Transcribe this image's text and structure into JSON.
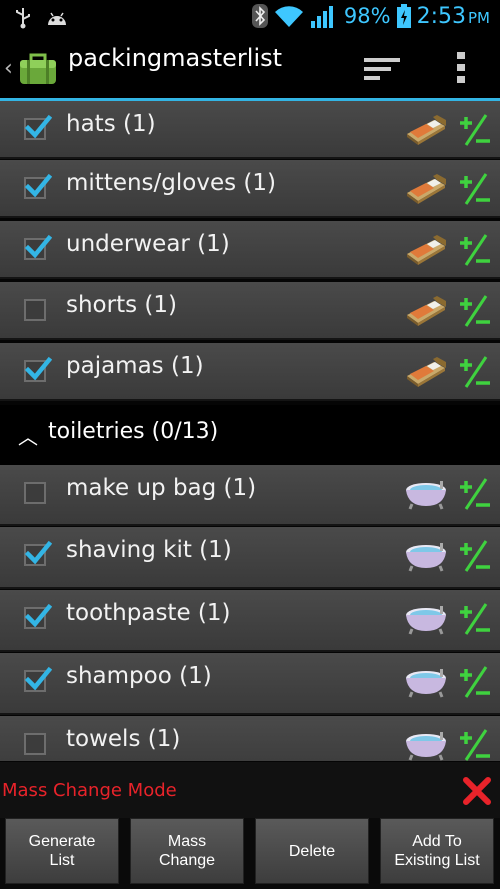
{
  "status_bar": {
    "battery": "98%",
    "time": "2:53",
    "ampm": "PM",
    "icons": [
      "usb-icon",
      "android-icon",
      "bluetooth-icon",
      "wifi-icon",
      "signal-icon",
      "battery-icon"
    ]
  },
  "action_bar": {
    "title": "packingmasterlist",
    "icons": [
      "suitcase-icon",
      "sort-icon",
      "overflow-menu-icon"
    ]
  },
  "groups": [
    {
      "items": [
        {
          "label": "hats (1)",
          "checked": true,
          "icon": "bed-icon"
        },
        {
          "label": "mittens/gloves (1)",
          "checked": true,
          "icon": "bed-icon"
        },
        {
          "label": "underwear (1)",
          "checked": true,
          "icon": "bed-icon"
        },
        {
          "label": "shorts (1)",
          "checked": false,
          "icon": "bed-icon"
        },
        {
          "label": "pajamas (1)",
          "checked": true,
          "icon": "bed-icon"
        }
      ]
    },
    {
      "header": "toiletries (0/13)",
      "expanded": true,
      "items": [
        {
          "label": "make up bag (1)",
          "checked": false,
          "icon": "bathtub-icon"
        },
        {
          "label": "shaving kit (1)",
          "checked": true,
          "icon": "bathtub-icon"
        },
        {
          "label": "toothpaste (1)",
          "checked": true,
          "icon": "bathtub-icon"
        },
        {
          "label": "shampoo (1)",
          "checked": true,
          "icon": "bathtub-icon"
        },
        {
          "label": "towels (1)",
          "checked": false,
          "icon": "bathtub-icon"
        }
      ]
    }
  ],
  "mass_change": {
    "label": "Mass Change Mode",
    "close_icon": "close-icon"
  },
  "buttons": [
    {
      "line1": "Generate",
      "line2": "List"
    },
    {
      "line1": "Mass",
      "line2": "Change"
    },
    {
      "line1": "Delete",
      "line2": ""
    },
    {
      "line1": "Add To",
      "line2": "Existing List"
    }
  ],
  "colors": {
    "accent": "#33b5e5",
    "mass_mode": "#e8232a",
    "plus_minus": "#3fd23f"
  }
}
